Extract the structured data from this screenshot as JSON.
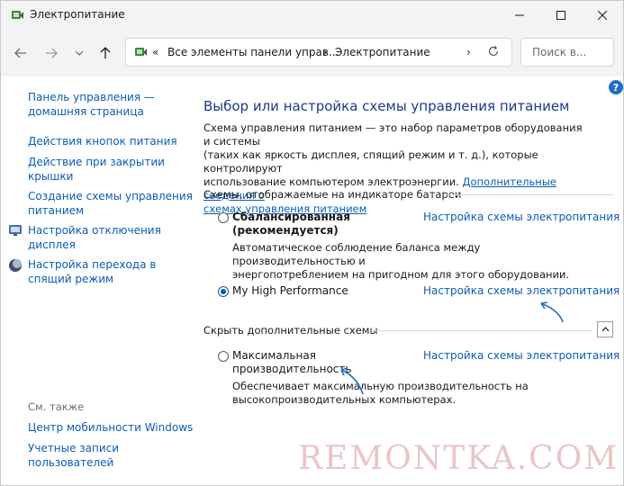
{
  "window": {
    "title": "Электропитание"
  },
  "address": {
    "crumb_overflow": "«",
    "crumb_1": "Все элементы панели управ...",
    "separator_1": "›",
    "crumb_2": "Электропитание",
    "separator_2": "›",
    "search_placeholder": "Поиск в..."
  },
  "sidebar": {
    "home_line1": "Панель управления —",
    "home_line2": "домашняя страница",
    "items": [
      {
        "line1": "Действия кнопок питания",
        "line2": ""
      },
      {
        "line1": "Действие при закрытии",
        "line2": "крышки"
      },
      {
        "line1": "Создание схемы управления",
        "line2": "питанием"
      },
      {
        "line1": "Настройка отключения",
        "line2": "дисплея"
      },
      {
        "line1": "Настройка перехода в",
        "line2": "спящий режим"
      }
    ],
    "see_also": "См. также",
    "see_also_items": [
      {
        "line1": "Центр мобильности Windows",
        "line2": ""
      },
      {
        "line1": "Учетные записи",
        "line2": "пользователей"
      }
    ]
  },
  "main": {
    "heading": "Выбор или настройка схемы управления питанием",
    "desc_line1": "Схема управления питанием — это набор параметров оборудования и системы",
    "desc_line2": "(таких как яркость дисплея, спящий режим и т. д.), которые контролируют",
    "desc_line3_text": "использование компьютером электроэнергии.",
    "desc_line3_link": "Дополнительные сведения о",
    "desc_line4_link": "схемах управления питанием",
    "battery_section": "Схемы, отображаемые на индикаторе батареи",
    "hidden_section": "Скрыть дополнительные схемы",
    "plans": [
      {
        "name_line1": "Сбалансированная",
        "name_line2": "(рекомендуется)",
        "link": "Настройка схемы электропитания",
        "desc_line1": "Автоматическое соблюдение баланса между производительностью и",
        "desc_line2": "энергопотреблением на пригодном для этого оборудовании.",
        "selected": false
      },
      {
        "name_line1": "My High Performance",
        "name_line2": "",
        "link": "Настройка схемы электропитания",
        "desc_line1": "",
        "desc_line2": "",
        "selected": true
      },
      {
        "name_line1": "Максимальная",
        "name_line2": "производительность",
        "link": "Настройка схемы электропитания",
        "desc_line1": "Обеспечивает максимальную производительность на",
        "desc_line2": "высокопроизводительных компьютерах.",
        "selected": false
      }
    ]
  },
  "watermark": "REMONTKA.COM",
  "colors": {
    "link": "#0c5cb3",
    "heading": "#1c3a8a",
    "annotation_arrow": "#1e6fc8",
    "watermark": "#e9c6c6"
  }
}
